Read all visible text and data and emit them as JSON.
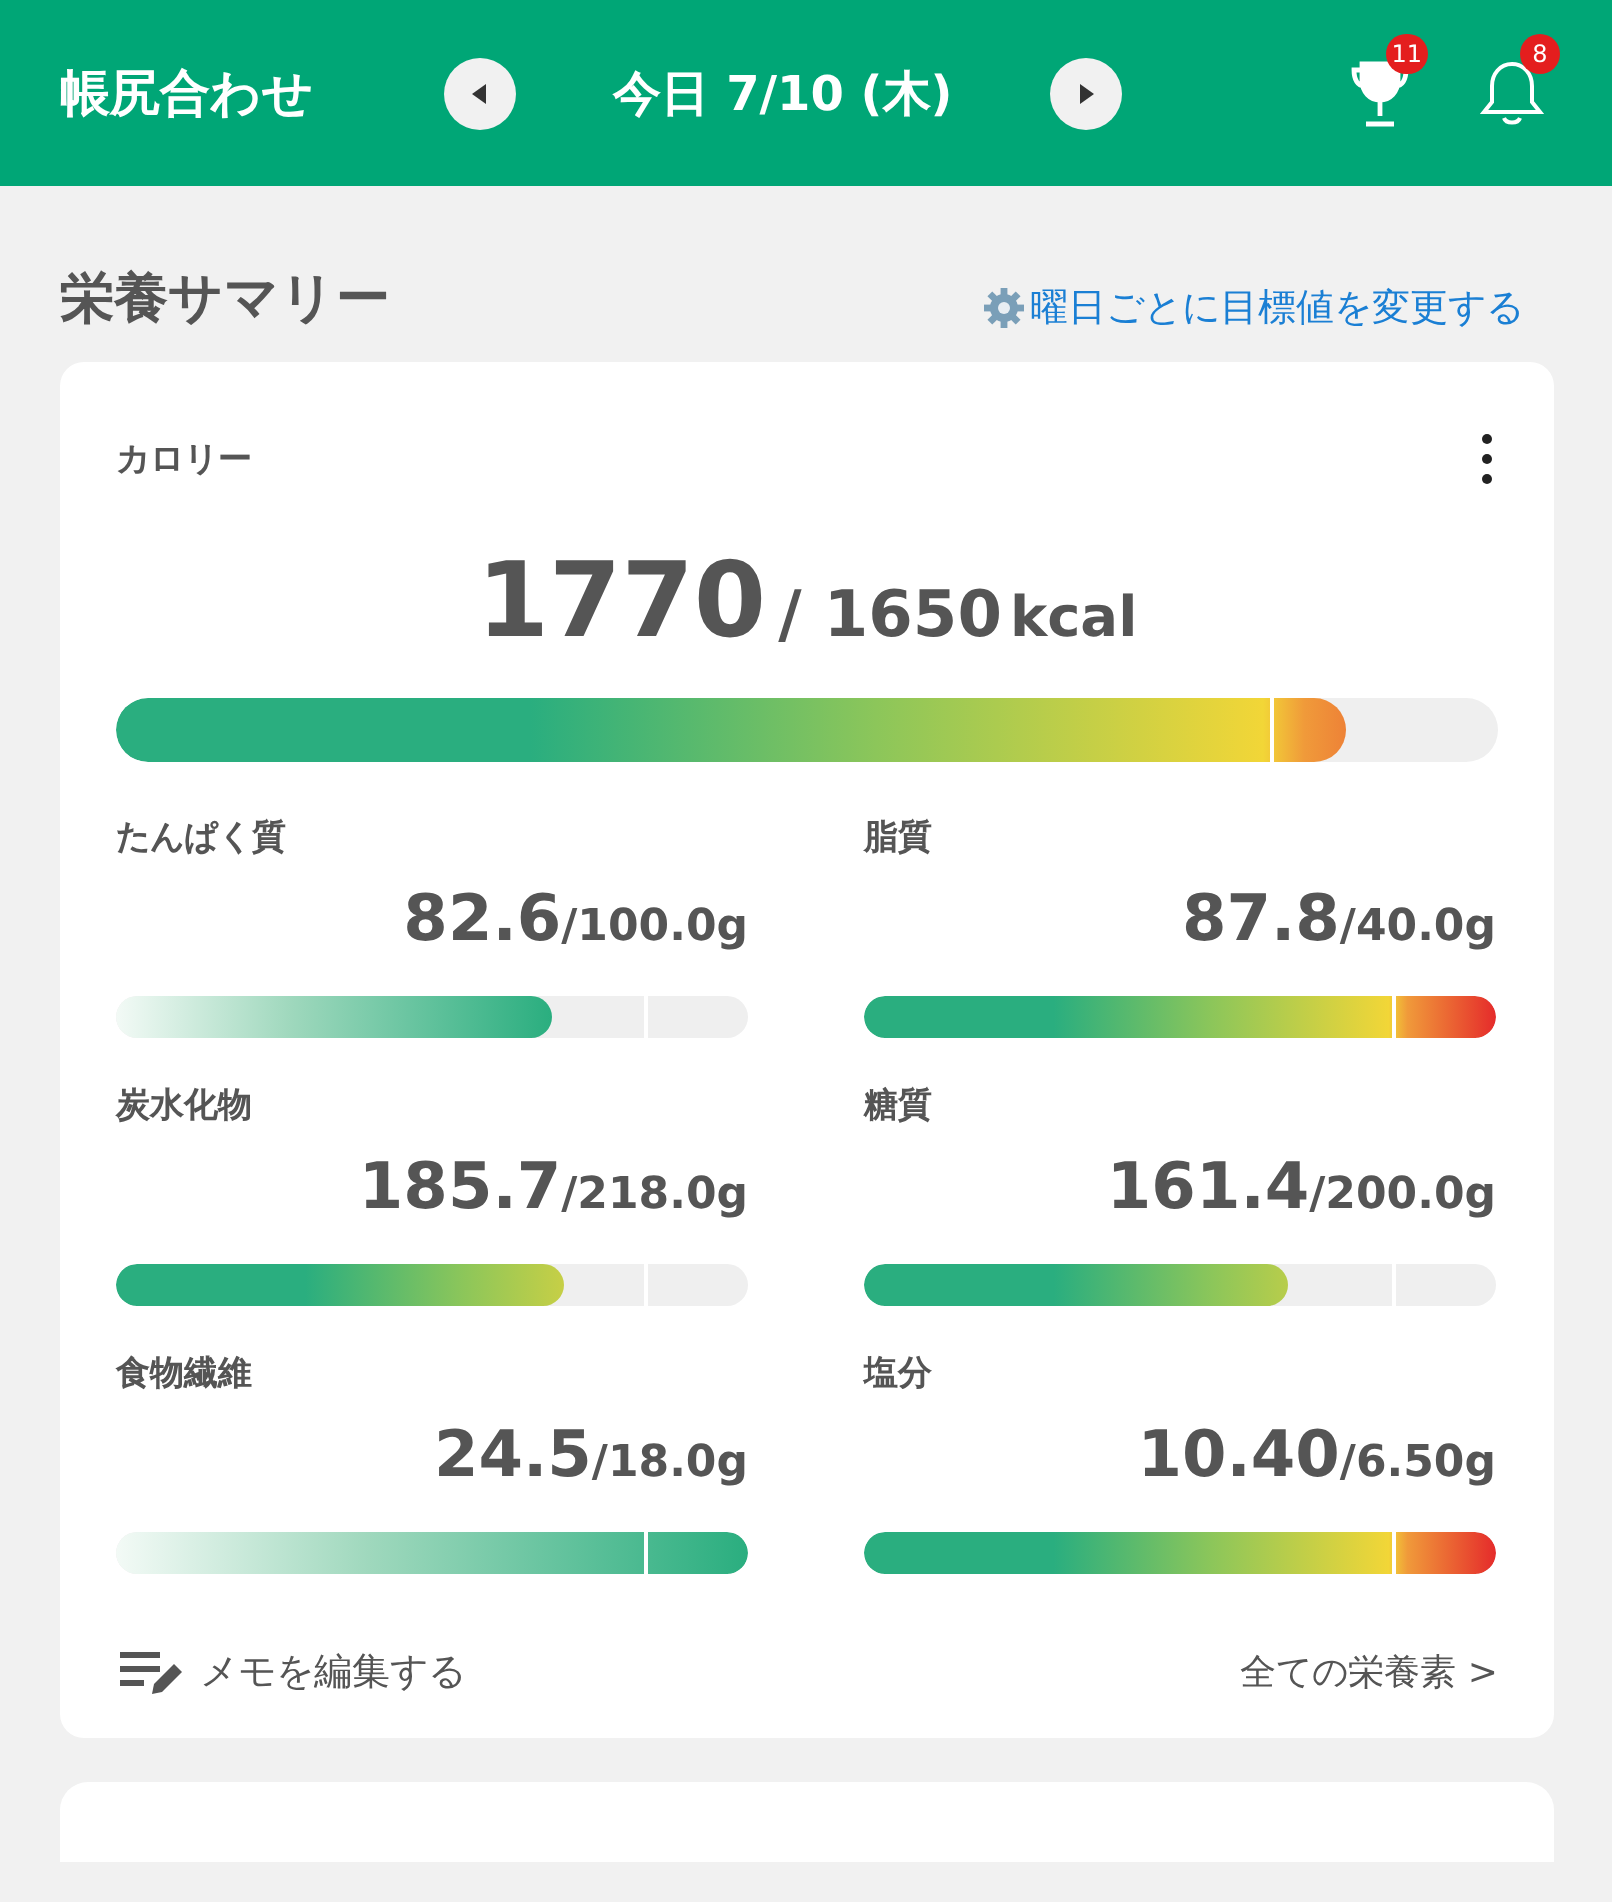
{
  "header": {
    "title": "帳尻合わせ",
    "date": "今日 7/10 (木)",
    "trophy_badge": "11",
    "bell_badge": "8"
  },
  "section": {
    "title": "栄養サマリー",
    "link": "曜日ごとに目標値を変更する"
  },
  "calorie": {
    "label": "カロリー",
    "value": "1770",
    "target": "/ 1650",
    "unit": "kcal",
    "level": 0.89,
    "kind": "limit"
  },
  "nutrients": [
    {
      "label": "たんぱく質",
      "value": "82.6",
      "target": "/100.0g",
      "level": 0.69,
      "kind": "goal"
    },
    {
      "label": "脂質",
      "value": "87.8",
      "target": "/40.0g",
      "level": 1,
      "kind": "limit"
    },
    {
      "label": "炭水化物",
      "value": "185.7",
      "target": "/218.0g",
      "level": 0.71,
      "kind": "limit"
    },
    {
      "label": "糖質",
      "value": "161.4",
      "target": "/200.0g",
      "level": 0.67,
      "kind": "limit"
    },
    {
      "label": "食物繊維",
      "value": "24.5",
      "target": "/18.0g",
      "level": 1,
      "kind": "goal"
    },
    {
      "label": "塩分",
      "value": "10.40",
      "target": "/6.50g",
      "level": 1,
      "kind": "limit"
    }
  ],
  "footer": {
    "memo": "メモを編集する",
    "all": "全ての栄養素 >"
  }
}
